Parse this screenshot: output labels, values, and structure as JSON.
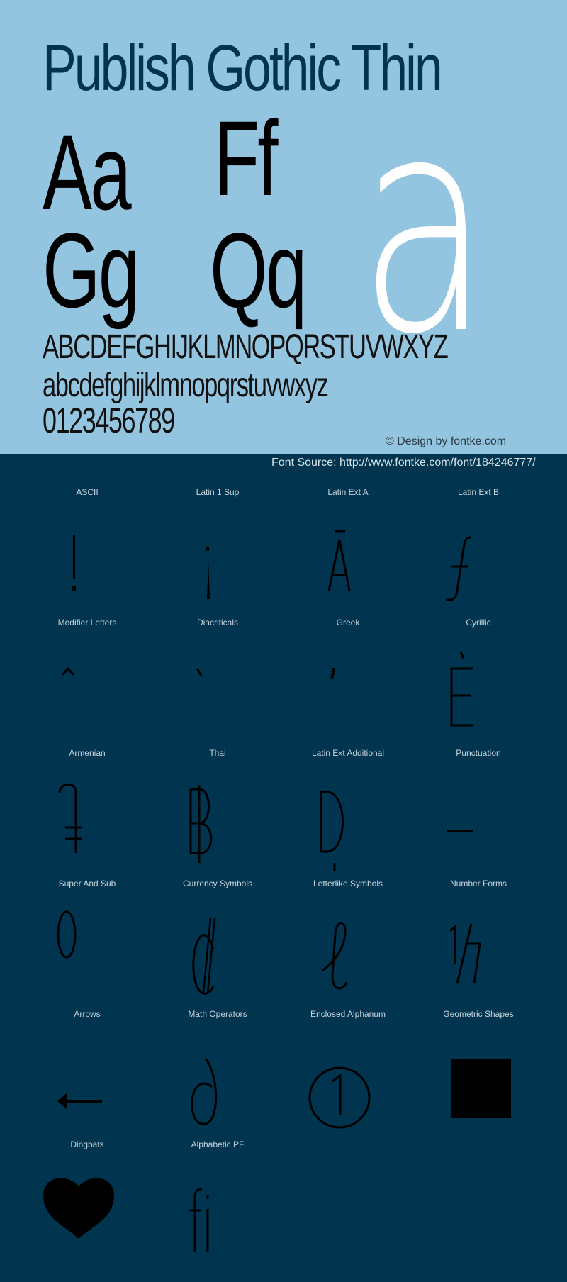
{
  "hero": {
    "title": "Publish Gothic Thin",
    "pairs": [
      "Aa",
      "Ff",
      "Gg",
      "Qq"
    ],
    "big_glyph": "a",
    "uppercase": "ABCDEFGHIJKLMNOPQRSTUVWXYZ",
    "lowercase": "abcdefghijklmnopqrstuvwxyz",
    "digits": "0123456789",
    "credit": "© Design by fontke.com",
    "colors": {
      "background": "#93c5e1",
      "title": "#02344f",
      "big_glyph": "#ffffff"
    }
  },
  "source": {
    "text": "Font Source: http://www.fontke.com/font/184246777/"
  },
  "grid": {
    "background": "#01344f",
    "cells": [
      {
        "label": "ASCII",
        "glyph": "!",
        "icon": "exclamation-glyph"
      },
      {
        "label": "Latin 1 Sup",
        "glyph": "¡",
        "icon": "inverted-exclamation-glyph"
      },
      {
        "label": "Latin Ext A",
        "glyph": "Ā",
        "icon": "a-macron-glyph"
      },
      {
        "label": "Latin Ext B",
        "glyph": "ƒ",
        "icon": "f-hook-glyph"
      },
      {
        "label": "Modifier Letters",
        "glyph": "ˆ",
        "icon": "circumflex-glyph"
      },
      {
        "label": "Diacriticals",
        "glyph": "̀",
        "icon": "grave-accent-glyph"
      },
      {
        "label": "Greek",
        "glyph": "ʹ",
        "icon": "greek-tonos-glyph"
      },
      {
        "label": "Cyrillic",
        "glyph": "Ѐ",
        "icon": "e-grave-glyph"
      },
      {
        "label": "Armenian",
        "glyph": "֏",
        "icon": "dram-sign-glyph"
      },
      {
        "label": "Thai",
        "glyph": "฿",
        "icon": "baht-sign-glyph"
      },
      {
        "label": "Latin Ext Additional",
        "glyph": "Ḍ",
        "icon": "d-dot-below-glyph"
      },
      {
        "label": "Punctuation",
        "glyph": "–",
        "icon": "en-dash-glyph"
      },
      {
        "label": "Super And Sub",
        "glyph": "⁰",
        "icon": "superscript-zero-glyph"
      },
      {
        "label": "Currency Symbols",
        "glyph": "₵",
        "icon": "cedi-sign-glyph"
      },
      {
        "label": "Letterlike Symbols",
        "glyph": "ℓ",
        "icon": "script-l-glyph"
      },
      {
        "label": "Number Forms",
        "glyph": "⅐",
        "icon": "one-seventh-glyph"
      },
      {
        "label": "Arrows",
        "glyph": "←",
        "icon": "left-arrow-icon"
      },
      {
        "label": "Math Operators",
        "glyph": "∂",
        "icon": "partial-differential-glyph"
      },
      {
        "label": "Enclosed Alphanum",
        "glyph": "①",
        "icon": "circled-one-glyph"
      },
      {
        "label": "Geometric Shapes",
        "glyph": "■",
        "icon": "black-square-icon"
      },
      {
        "label": "Dingbats",
        "glyph": "❤",
        "icon": "heart-icon"
      },
      {
        "label": "Alphabetic PF",
        "glyph": "ﬁ",
        "icon": "fi-ligature-glyph"
      }
    ]
  }
}
